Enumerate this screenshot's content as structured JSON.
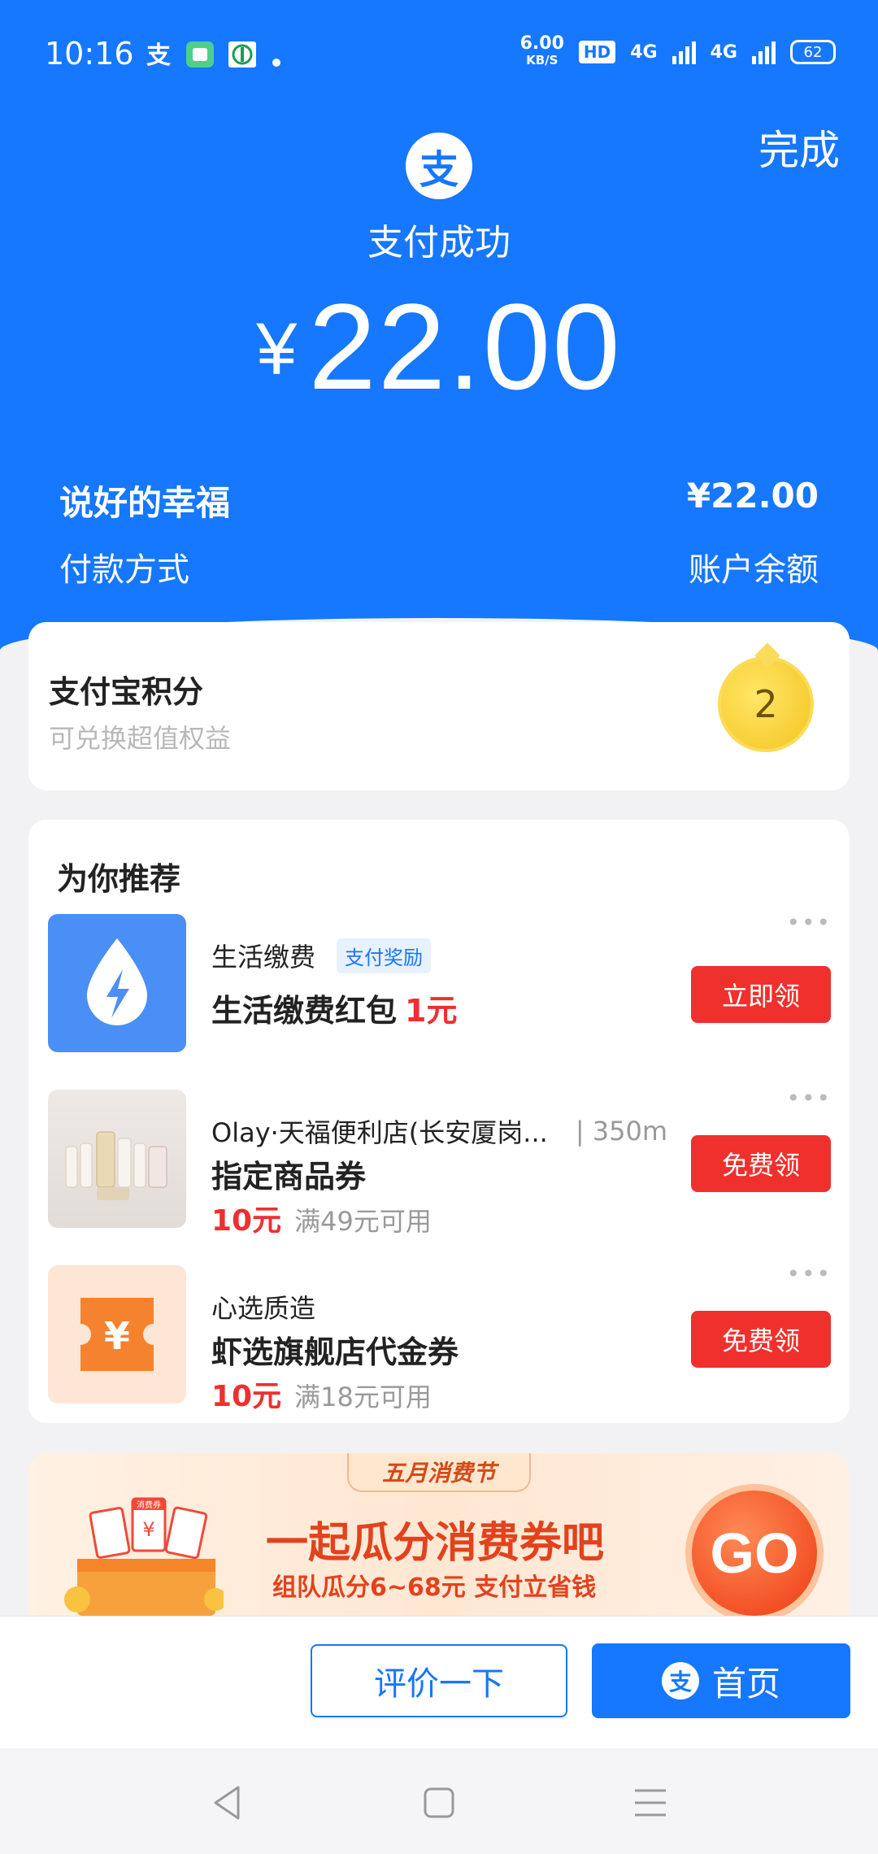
{
  "status_bar": {
    "time": "10:16",
    "net_speed": "6.00",
    "net_unit": "KB/S",
    "hd": "HD",
    "sig1": "4G",
    "sig2": "4G",
    "battery": "62"
  },
  "header": {
    "done_label": "完成",
    "logo_icon": "alipay-logo",
    "logo_char": "支",
    "title": "支付成功",
    "currency": "¥",
    "amount": "22.00"
  },
  "summary": {
    "merchant": "说好的幸福",
    "amount": "¥22.00",
    "method_label": "付款方式",
    "method_value": "账户余额"
  },
  "points": {
    "title": "支付宝积分",
    "subtitle": "可兑换超值权益",
    "value": "2"
  },
  "recommend": {
    "title": "为你推荐",
    "more": "•••",
    "items": [
      {
        "subtitle": "生活缴费",
        "tag": "支付奖励",
        "main": "生活缴费红包",
        "highlight": "1元",
        "button": "立即领"
      },
      {
        "subtitle": "Olay·天福便利店(长安厦岗...",
        "distance": "| 350m",
        "main": "指定商品券",
        "highlight": "10元",
        "condition": "满49元可用",
        "button": "免费领"
      },
      {
        "subtitle": "心选质造",
        "icon_char": "¥",
        "main": "虾选旗舰店代金券",
        "highlight": "10元",
        "condition": "满18元可用",
        "button": "免费领"
      }
    ]
  },
  "banner": {
    "tag": "五月消费节",
    "title": "一起瓜分消费券吧",
    "subtitle": "组队瓜分6~68元  支付立省钱",
    "go": "GO",
    "gift_label": "消费券"
  },
  "footer": {
    "rate_label": "评价一下",
    "home_label": "首页",
    "home_icon_char": "支"
  },
  "colors": {
    "brand_blue": "#1677ff",
    "red": "#f0302d"
  }
}
